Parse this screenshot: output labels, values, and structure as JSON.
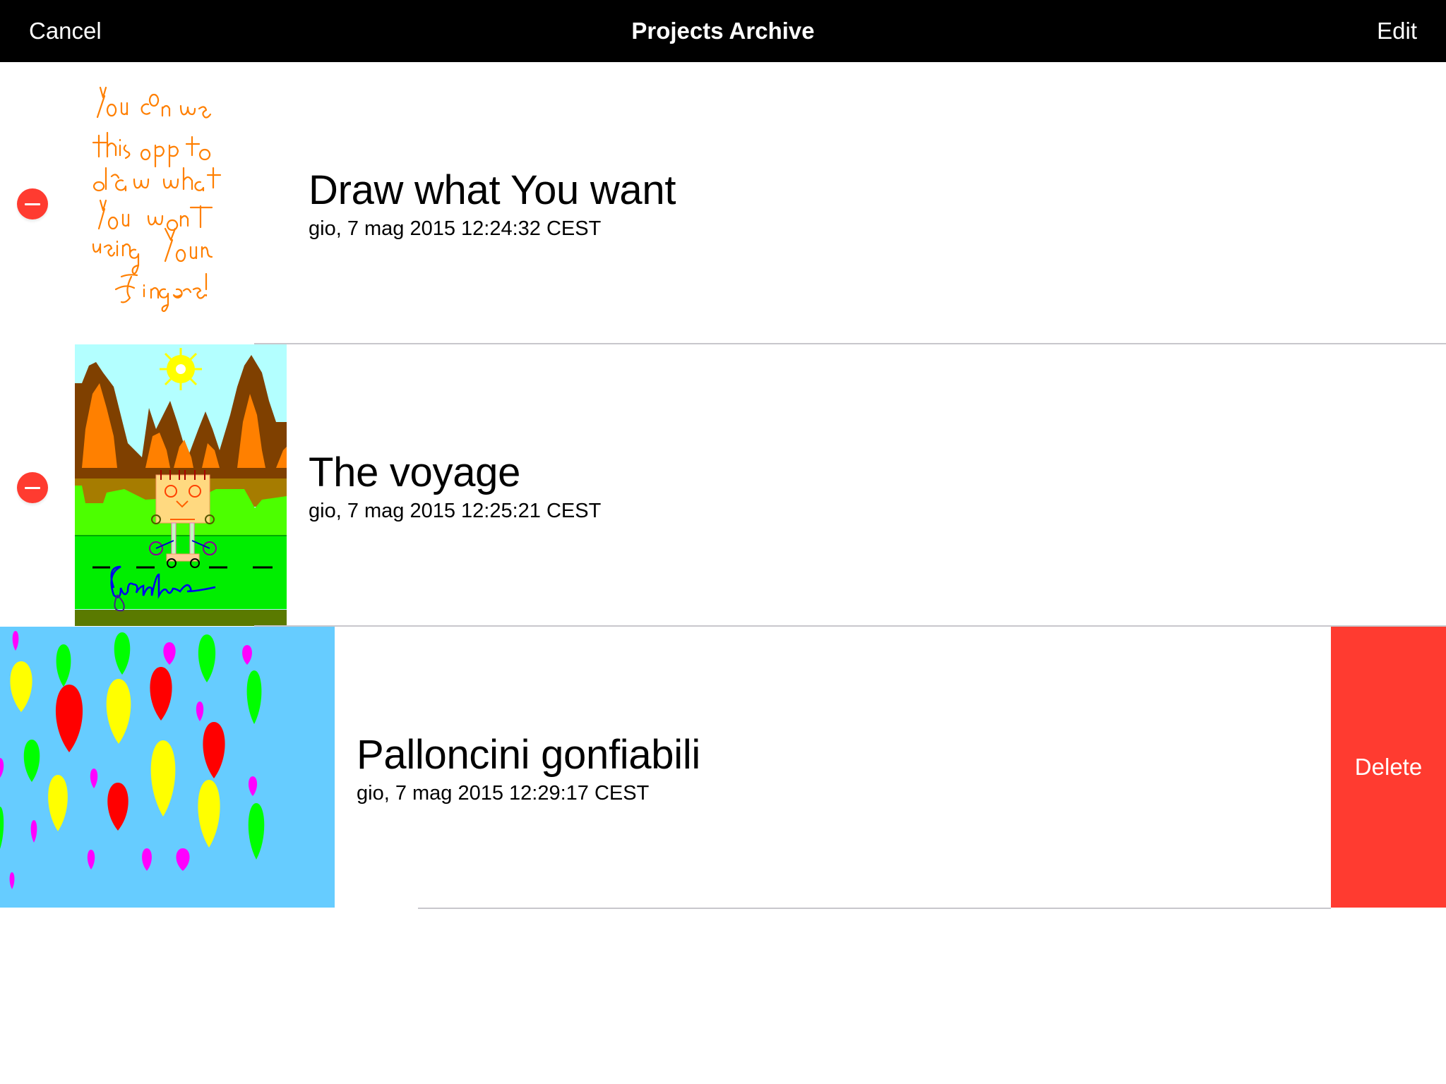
{
  "navbar": {
    "left_button": "Cancel",
    "title": "Projects Archive",
    "right_button": "Edit"
  },
  "projects": [
    {
      "title": "Draw what You want",
      "date": "gio, 7 mag 2015 12:24:32 CEST",
      "thumbnail": "handwritten-note",
      "thumbnail_text": [
        "You can use",
        "this app to",
        "draw what",
        "You want",
        "using Your",
        "fingers!"
      ],
      "delete_control": "minus-circle-icon"
    },
    {
      "title": "The voyage",
      "date": "gio, 7 mag 2015 12:25:21 CEST",
      "thumbnail": "landscape-robot-drawing",
      "thumbnail_signature": "Gianluca.",
      "delete_control": "minus-circle-icon"
    },
    {
      "title": "Palloncini gonfiabili",
      "date": "gio, 7 mag 2015 12:29:17 CEST",
      "thumbnail": "balloons-drawing",
      "swiped": true,
      "delete_label": "Delete"
    }
  ],
  "colors": {
    "navbar_bg": "#000000",
    "delete_red": "#ff3b30",
    "separator": "#c8c7cc",
    "handwriting_orange": "#ff7f00",
    "sky_blue": "#66ccff"
  }
}
